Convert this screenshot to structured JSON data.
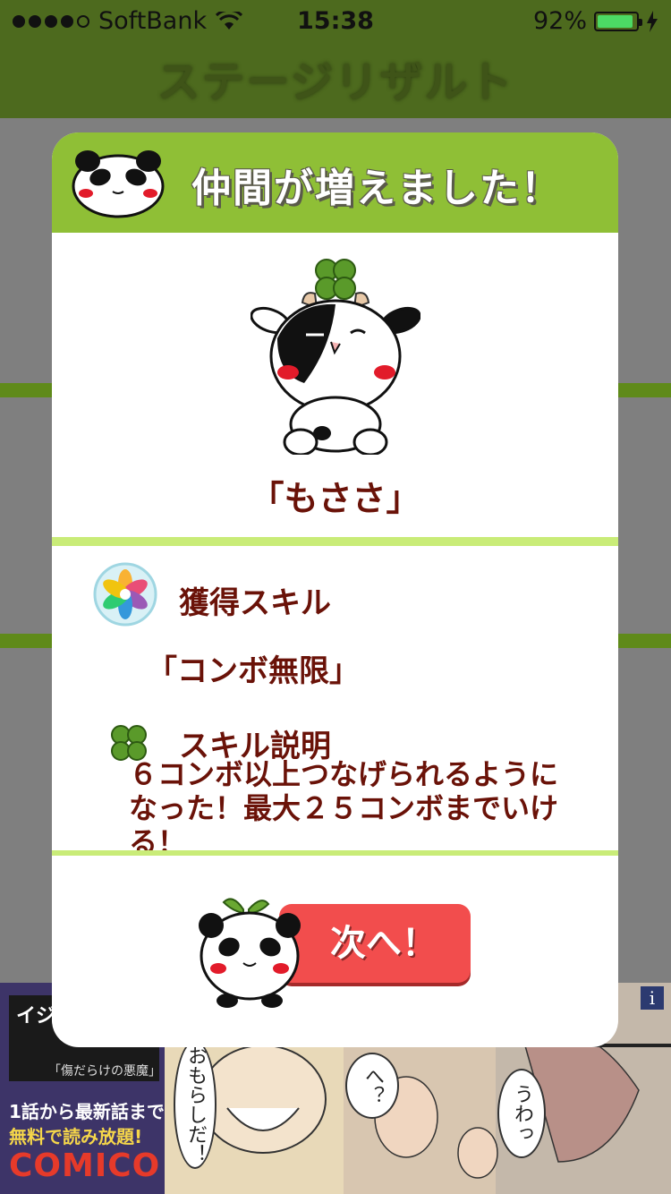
{
  "status_bar": {
    "carrier": "SoftBank",
    "time": "15:38",
    "battery": "92%",
    "battery_level": 0.92
  },
  "nav": {
    "title": "ステージリザルト"
  },
  "dialog": {
    "title": "仲間が増えました！",
    "character_name": "「もささ」",
    "skill_heading": "獲得スキル",
    "skill_name": "「コンボ無限」",
    "description_heading": "スキル説明",
    "description": "６コンボ以上つなげられるようになった！最大２５コンボまでいける！",
    "next_button": "次へ！"
  },
  "ad": {
    "headline": "イジメ 閉じ込",
    "subtitle": "「傷だらけの悪魔」",
    "line1": "1話から最新話まで",
    "line2": "無料で読み放題!",
    "brand": "COMICO",
    "bubble1": "おもらしだ！",
    "bubble2": "へ？",
    "bubble3": "うわっ",
    "info": "i"
  },
  "colors": {
    "nav_bg": "#4d6a1e",
    "dialog_header": "#8fbf36",
    "text_brown": "#6a1208",
    "button_red": "#f24d4d",
    "divider": "#c9ec78"
  }
}
